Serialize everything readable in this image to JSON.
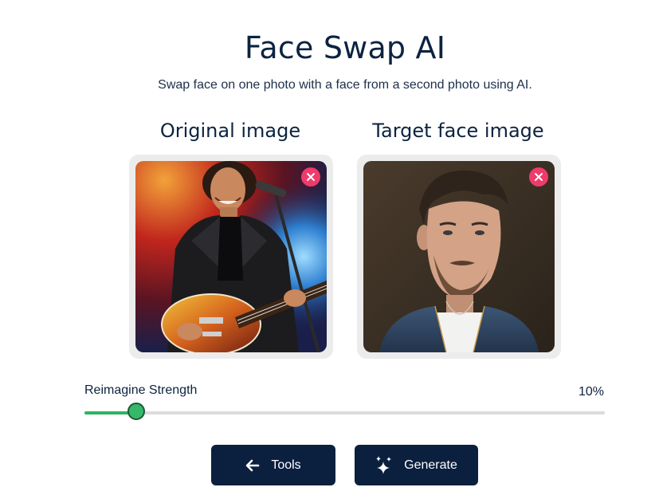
{
  "header": {
    "title": "Face Swap AI",
    "subtitle": "Swap face on one photo with a face from a second photo using AI."
  },
  "panels": [
    {
      "label": "Original image",
      "image": "man with black leather jacket playing electric guitar and singing into microphone on stage",
      "remove_icon": "close-icon"
    },
    {
      "label": "Target face image",
      "image": "portrait of bearded man with styled hair wearing denim jacket",
      "remove_icon": "close-icon"
    }
  ],
  "slider": {
    "label": "Reimagine Strength",
    "value_text": "10%",
    "value": 0.1
  },
  "buttons": {
    "tools_label": "Tools",
    "tools_icon": "arrow-left-icon",
    "generate_label": "Generate",
    "generate_icon": "sparkles-icon"
  },
  "colors": {
    "primary_dark": "#0b1f3f",
    "accent_green": "#35b86a",
    "remove_pink": "#ef3b6b"
  }
}
